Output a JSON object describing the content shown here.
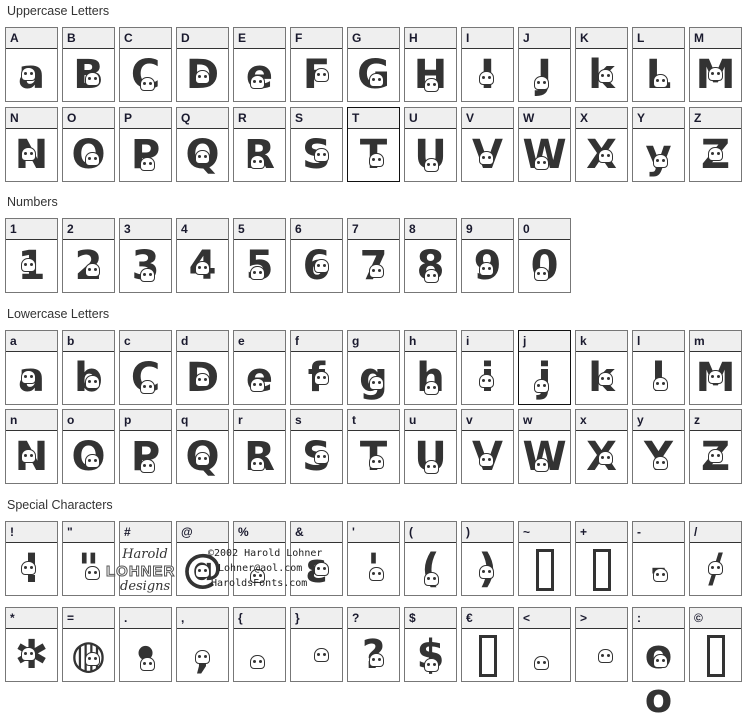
{
  "sections": {
    "uppercase": {
      "title": "Uppercase Letters"
    },
    "numbers": {
      "title": "Numbers"
    },
    "lowercase": {
      "title": "Lowercase Letters"
    },
    "special": {
      "title": "Special Characters"
    }
  },
  "rows": {
    "upper1": [
      {
        "label": "A",
        "glyph": "a"
      },
      {
        "label": "B",
        "glyph": "B"
      },
      {
        "label": "C",
        "glyph": "C"
      },
      {
        "label": "D",
        "glyph": "D"
      },
      {
        "label": "E",
        "glyph": "e"
      },
      {
        "label": "F",
        "glyph": "F"
      },
      {
        "label": "G",
        "glyph": "G"
      },
      {
        "label": "H",
        "glyph": "H"
      },
      {
        "label": "I",
        "glyph": "I"
      },
      {
        "label": "J",
        "glyph": "J"
      },
      {
        "label": "K",
        "glyph": "k"
      },
      {
        "label": "L",
        "glyph": "L"
      },
      {
        "label": "M",
        "glyph": "M"
      }
    ],
    "upper2": [
      {
        "label": "N",
        "glyph": "N"
      },
      {
        "label": "O",
        "glyph": "O"
      },
      {
        "label": "P",
        "glyph": "P"
      },
      {
        "label": "Q",
        "glyph": "Q"
      },
      {
        "label": "R",
        "glyph": "R"
      },
      {
        "label": "S",
        "glyph": "S"
      },
      {
        "label": "T",
        "glyph": "T",
        "active": true
      },
      {
        "label": "U",
        "glyph": "U"
      },
      {
        "label": "V",
        "glyph": "V"
      },
      {
        "label": "W",
        "glyph": "W"
      },
      {
        "label": "X",
        "glyph": "X"
      },
      {
        "label": "Y",
        "glyph": "y"
      },
      {
        "label": "Z",
        "glyph": "Z"
      }
    ],
    "numbers": [
      {
        "label": "1",
        "glyph": "1"
      },
      {
        "label": "2",
        "glyph": "2"
      },
      {
        "label": "3",
        "glyph": "3"
      },
      {
        "label": "4",
        "glyph": "4"
      },
      {
        "label": "5",
        "glyph": "5"
      },
      {
        "label": "6",
        "glyph": "6"
      },
      {
        "label": "7",
        "glyph": "7"
      },
      {
        "label": "8",
        "glyph": "8"
      },
      {
        "label": "9",
        "glyph": "9"
      },
      {
        "label": "0",
        "glyph": "0"
      }
    ],
    "lower1": [
      {
        "label": "a",
        "glyph": "a"
      },
      {
        "label": "b",
        "glyph": "b"
      },
      {
        "label": "c",
        "glyph": "C"
      },
      {
        "label": "d",
        "glyph": "D"
      },
      {
        "label": "e",
        "glyph": "e"
      },
      {
        "label": "f",
        "glyph": "f"
      },
      {
        "label": "g",
        "glyph": "g"
      },
      {
        "label": "h",
        "glyph": "h"
      },
      {
        "label": "i",
        "glyph": "i"
      },
      {
        "label": "j",
        "glyph": "j",
        "active": true
      },
      {
        "label": "k",
        "glyph": "k"
      },
      {
        "label": "l",
        "glyph": "l"
      },
      {
        "label": "m",
        "glyph": "M"
      }
    ],
    "lower2": [
      {
        "label": "n",
        "glyph": "N"
      },
      {
        "label": "o",
        "glyph": "O"
      },
      {
        "label": "p",
        "glyph": "P"
      },
      {
        "label": "q",
        "glyph": "Q"
      },
      {
        "label": "r",
        "glyph": "R"
      },
      {
        "label": "s",
        "glyph": "S"
      },
      {
        "label": "t",
        "glyph": "T"
      },
      {
        "label": "u",
        "glyph": "U"
      },
      {
        "label": "v",
        "glyph": "V"
      },
      {
        "label": "w",
        "glyph": "W"
      },
      {
        "label": "x",
        "glyph": "X"
      },
      {
        "label": "y",
        "glyph": "Y"
      },
      {
        "label": "z",
        "glyph": "Z"
      }
    ],
    "special1": [
      {
        "label": "!",
        "glyph": "!"
      },
      {
        "label": "\"",
        "glyph": "\""
      },
      {
        "label": "#",
        "glyph": "",
        "logo": true
      },
      {
        "label": "@",
        "glyph": "@"
      },
      {
        "label": "%",
        "glyph": ""
      },
      {
        "label": "&",
        "glyph": "ε"
      },
      {
        "label": "'",
        "glyph": "'"
      },
      {
        "label": "(",
        "glyph": "("
      },
      {
        "label": ")",
        "glyph": ")"
      },
      {
        "label": "~",
        "glyph": "",
        "box": true
      },
      {
        "label": "+",
        "glyph": "",
        "box": true
      },
      {
        "label": "-",
        "glyph": "-"
      },
      {
        "label": "/",
        "glyph": "/"
      }
    ],
    "special2": [
      {
        "label": "*",
        "glyph": "✱"
      },
      {
        "label": "=",
        "glyph": "◍"
      },
      {
        "label": ".",
        "glyph": "•"
      },
      {
        "label": ",",
        "glyph": ","
      },
      {
        "label": "{",
        "glyph": ""
      },
      {
        "label": "}",
        "glyph": ""
      },
      {
        "label": "?",
        "glyph": "?"
      },
      {
        "label": "$",
        "glyph": "$"
      },
      {
        "label": "€",
        "glyph": "",
        "box": true
      },
      {
        "label": "<",
        "glyph": ""
      },
      {
        "label": ">",
        "glyph": ""
      },
      {
        "label": ":",
        "glyph": "o o"
      },
      {
        "label": "©",
        "glyph": "",
        "box": true
      }
    ]
  },
  "logo": {
    "line1": "Harold",
    "line2": "LOHNER",
    "line3": "designs"
  },
  "credit": {
    "line1": "©2002 Harold Lohner",
    "line2": "Lohner@aol.com",
    "line3": "HaroldsFonts.com"
  }
}
